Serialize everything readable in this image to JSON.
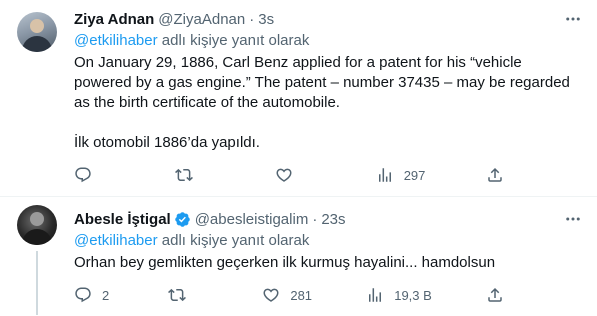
{
  "tweets": [
    {
      "name": "Ziya Adnan",
      "handle": "@ZiyaAdnan",
      "dot": "·",
      "time": "3s",
      "verified": false,
      "replying_prefix": "@etkilihaber",
      "replying_suffix": " adlı kişiye yanıt olarak",
      "paragraphs": [
        "On January 29, 1886, Carl Benz applied for a patent for his “vehicle powered by a gas engine.” The patent – number 37435 – may be regarded as the birth certificate of the automobile.",
        "İlk otomobil 1886’da yapıldı."
      ],
      "stats": {
        "replies": "",
        "retweets": "",
        "likes": "",
        "views": "297"
      }
    },
    {
      "name": "Abesle İştigal",
      "handle": "@abesleistigalim",
      "dot": "·",
      "time": "23s",
      "verified": true,
      "replying_prefix": "@etkilihaber",
      "replying_suffix": " adlı kişiye yanıt olarak",
      "paragraphs": [
        "Orhan bey gemlikten geçerken ilk kurmuş hayalini... hamdolsun"
      ],
      "stats": {
        "replies": "2",
        "retweets": "",
        "likes": "281",
        "views": "19,3 B"
      }
    }
  ],
  "colors": {
    "accent": "#1d9bf0",
    "muted": "#536471",
    "text": "#0f1419",
    "divider": "#eff3f4"
  },
  "icons": [
    "more-icon",
    "reply-icon",
    "retweet-icon",
    "like-icon",
    "views-icon",
    "share-icon",
    "verified-badge-icon"
  ]
}
